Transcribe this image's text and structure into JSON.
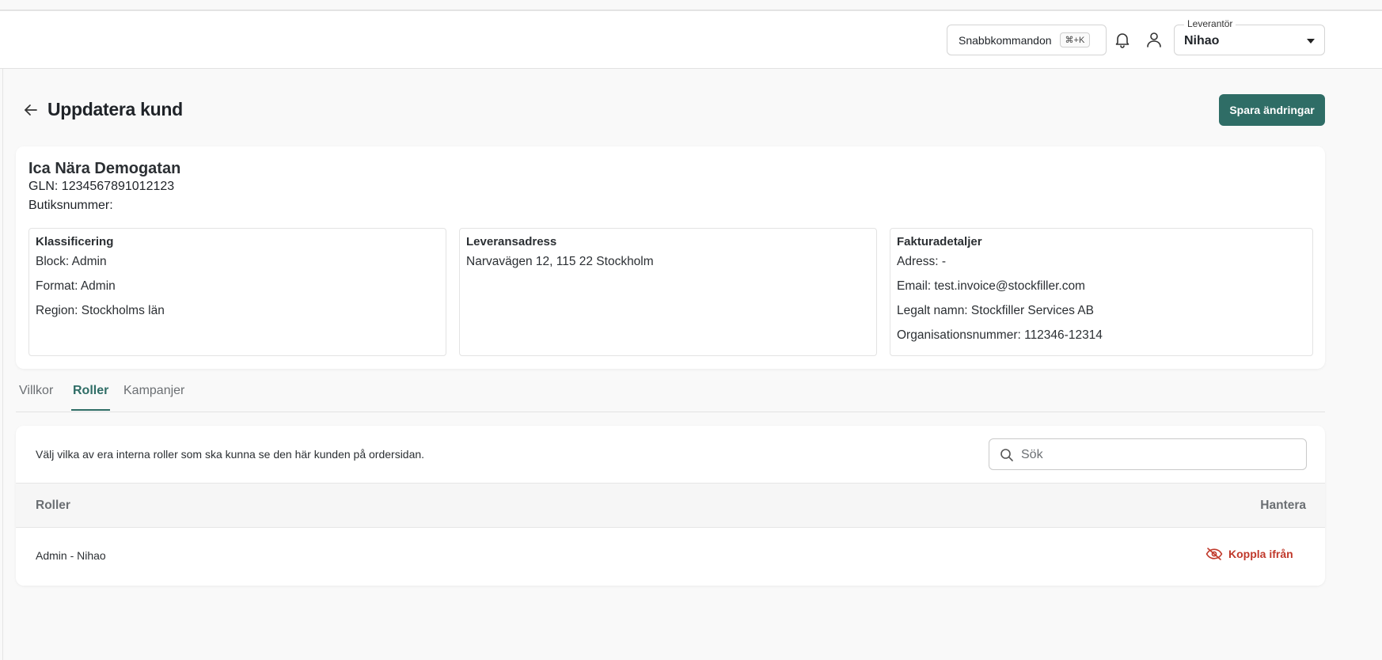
{
  "header": {
    "quick_commands_label": "Snabbkommandon",
    "quick_commands_shortcut": "⌘+K",
    "supplier_label": "Leverantör",
    "supplier_value": "Nihao"
  },
  "page": {
    "title": "Uppdatera kund",
    "save_label": "Spara ändringar"
  },
  "customer": {
    "name": "Ica Nära Demogatan",
    "gln": "GLN: 1234567891012123",
    "store_number": "Butiksnummer:",
    "classification": {
      "title": "Klassificering",
      "lines": [
        "Block: Admin",
        "Format: Admin",
        "Region: Stockholms län"
      ]
    },
    "delivery": {
      "title": "Leveransadress",
      "lines": [
        "Narvavägen 12, 115 22 Stockholm"
      ]
    },
    "invoice": {
      "title": "Fakturadetaljer",
      "lines": [
        "Adress: -",
        "Email: test.invoice@stockfiller.com",
        "Legalt namn: Stockfiller Services AB",
        "Organisationsnummer: 112346-12314"
      ]
    }
  },
  "tabs": [
    {
      "label": "Villkor",
      "active": false
    },
    {
      "label": "Roller",
      "active": true
    },
    {
      "label": "Kampanjer",
      "active": false
    }
  ],
  "roles": {
    "description": "Välj vilka av era interna roller som ska kunna se den här kunden på ordersidan.",
    "search_placeholder": "Sök",
    "columns": [
      "Roller",
      "Hantera"
    ],
    "rows": [
      {
        "name": "Admin - Nihao",
        "action": "Koppla ifrån"
      }
    ]
  },
  "colors": {
    "primary": "#2f6d66",
    "danger": "#c0392b"
  }
}
